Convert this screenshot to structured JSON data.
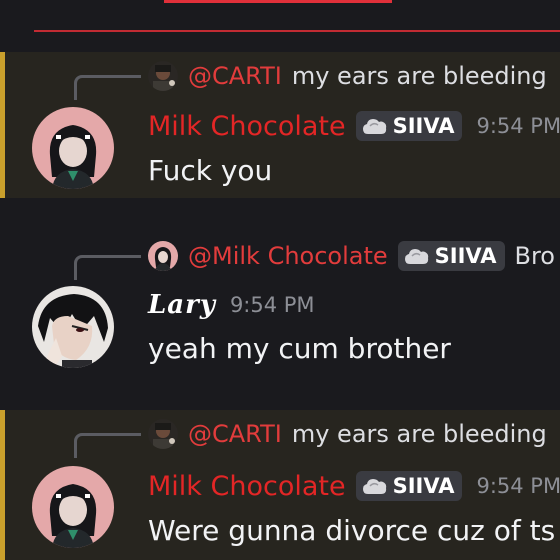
{
  "messages": [
    {
      "reply": {
        "mention": "@CARTI",
        "text": "my ears are bleeding"
      },
      "author": "Milk Chocolate",
      "tag": "SIIVA",
      "time": "9:54 PM",
      "content": "Fuck you"
    },
    {
      "reply": {
        "mention": "@Milk Chocolate",
        "tag": "SIIVA",
        "text": "Bro"
      },
      "author": "Lary",
      "time": "9:54 PM",
      "content": "yeah my cum brother"
    },
    {
      "reply": {
        "mention": "@CARTI",
        "text": "my ears are bleeding"
      },
      "author": "Milk Chocolate",
      "tag": "SIIVA",
      "time": "9:54 PM",
      "content": "Were gunna divorce cuz of ts"
    }
  ],
  "colors": {
    "background": "#1a1a1e",
    "highlight_background": "#27251f",
    "highlight_bar": "#c9a02c",
    "mention": "#e23c3c",
    "author_role": "#e32626",
    "timestamp": "#8d8f96"
  },
  "icons": {
    "tag_icon": "cloud-icon",
    "reply_connector": "reply-spine"
  }
}
